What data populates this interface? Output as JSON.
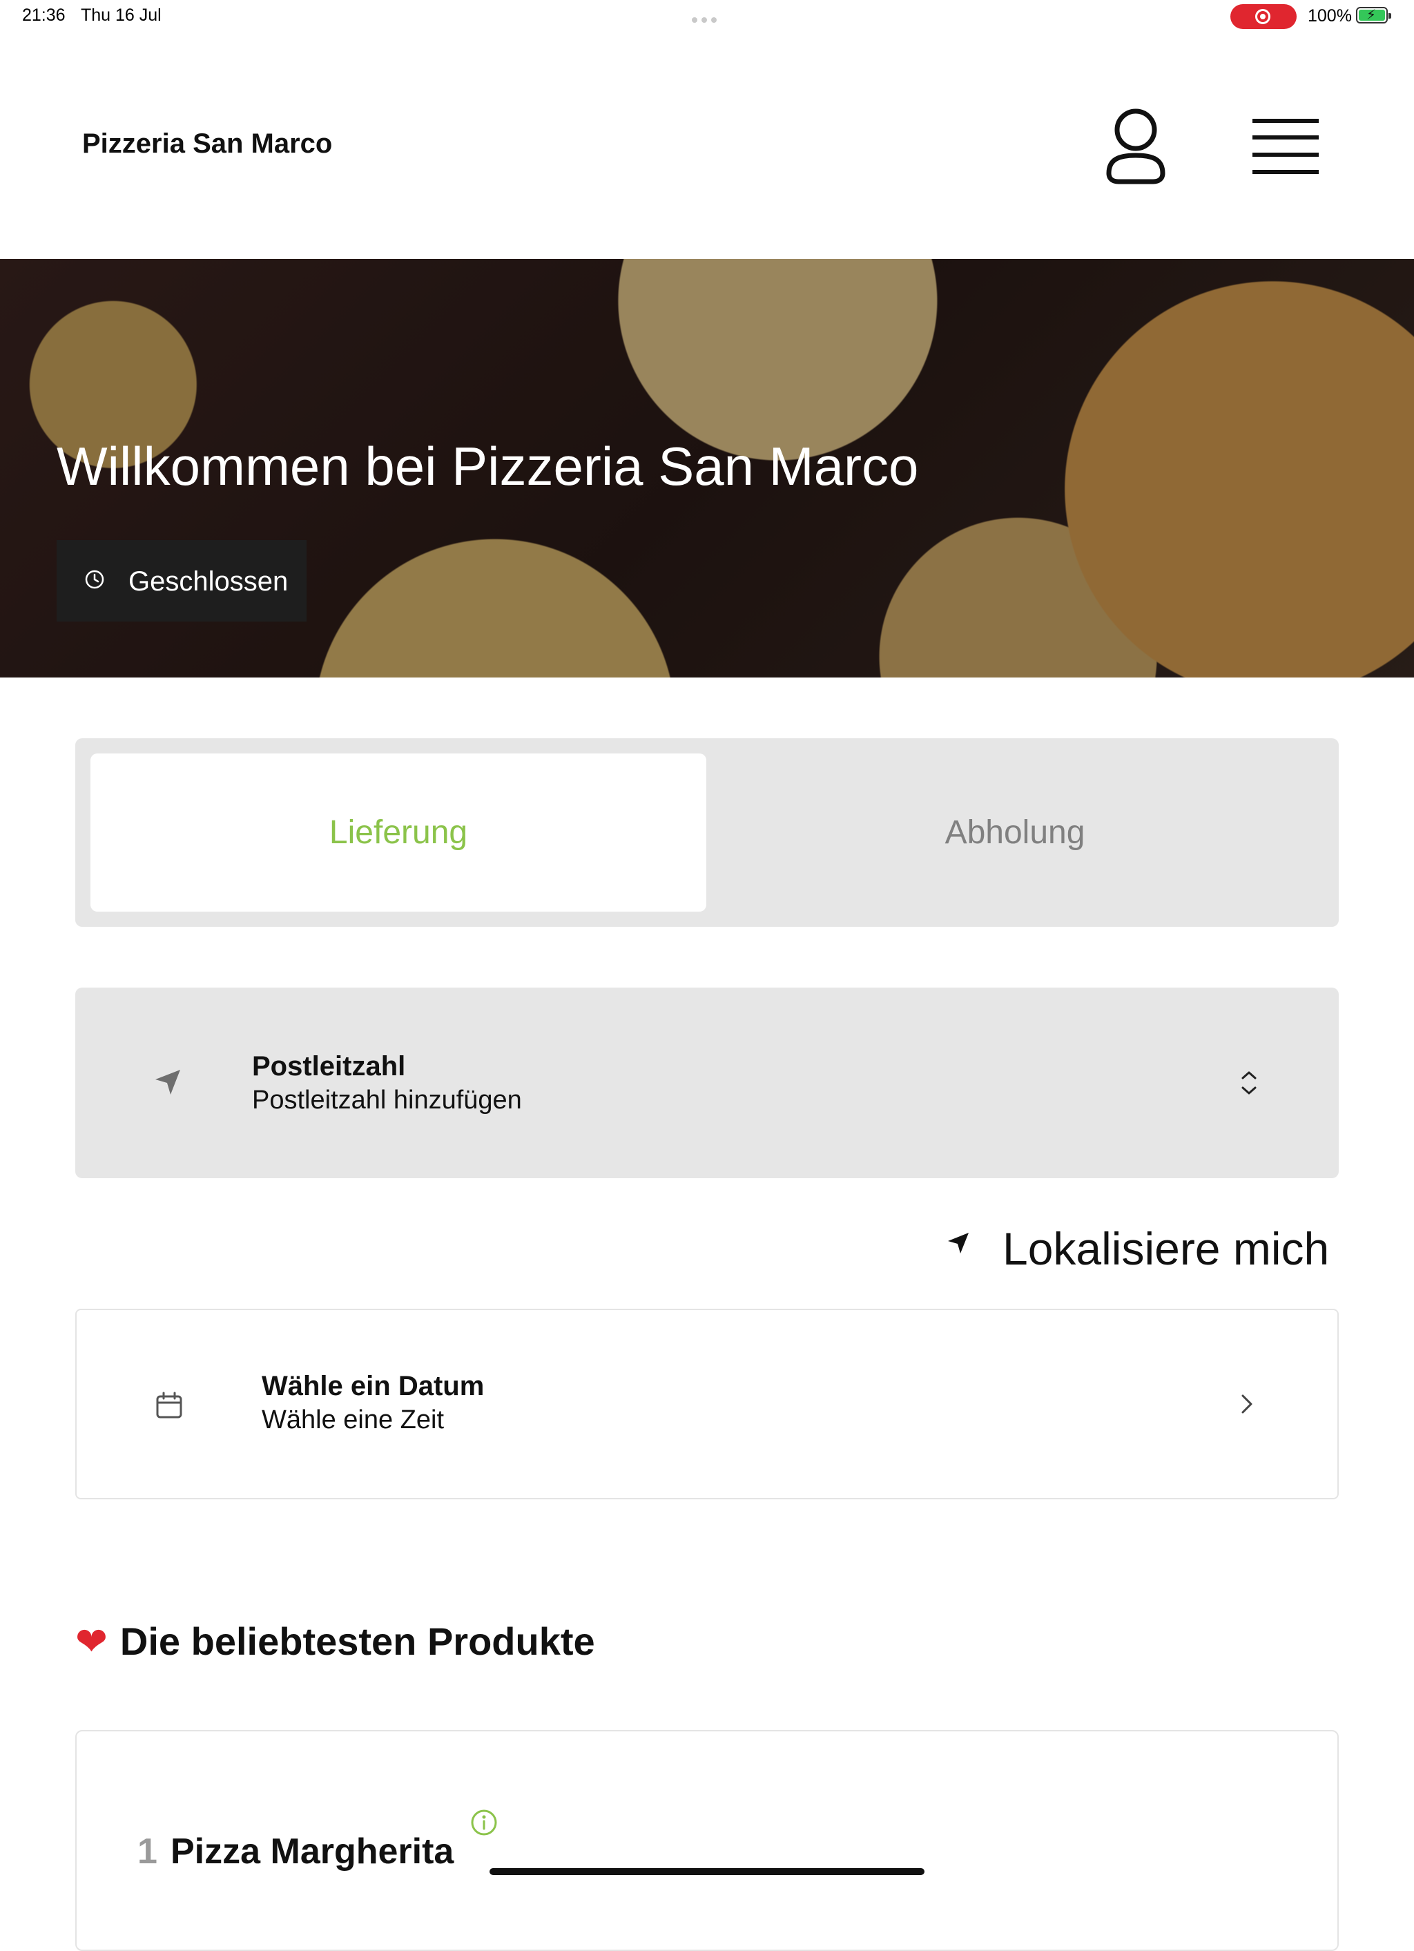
{
  "status_bar": {
    "time": "21:36",
    "date": "Thu 16 Jul",
    "battery_percent": "100%",
    "battery_level": 1.0,
    "recording_color": "#e0262f"
  },
  "header": {
    "title": "Pizzeria San Marco",
    "account_icon": "user-icon",
    "menu_icon": "hamburger-menu-icon"
  },
  "hero": {
    "title": "Willkommen bei Pizzeria San Marco",
    "status_label": "Geschlossen",
    "status_icon": "clock-icon"
  },
  "order_mode": {
    "tabs": [
      {
        "label": "Lieferung",
        "active": true
      },
      {
        "label": "Abholung",
        "active": false
      }
    ],
    "accent_color": "#8bc34a"
  },
  "postcode": {
    "title": "Postleitzahl",
    "placeholder": "Postleitzahl hinzufügen",
    "icon": "location-arrow-icon"
  },
  "locate": {
    "label": "Lokalisiere mich",
    "icon": "location-arrow-icon"
  },
  "schedule": {
    "title": "Wähle ein Datum",
    "subtitle": "Wähle eine Zeit",
    "icon": "calendar-icon"
  },
  "popular": {
    "heading": "Die beliebtesten Produkte",
    "heading_icon": "heart-icon",
    "products": [
      {
        "rank": "1",
        "name": "Pizza Margherita"
      }
    ]
  }
}
